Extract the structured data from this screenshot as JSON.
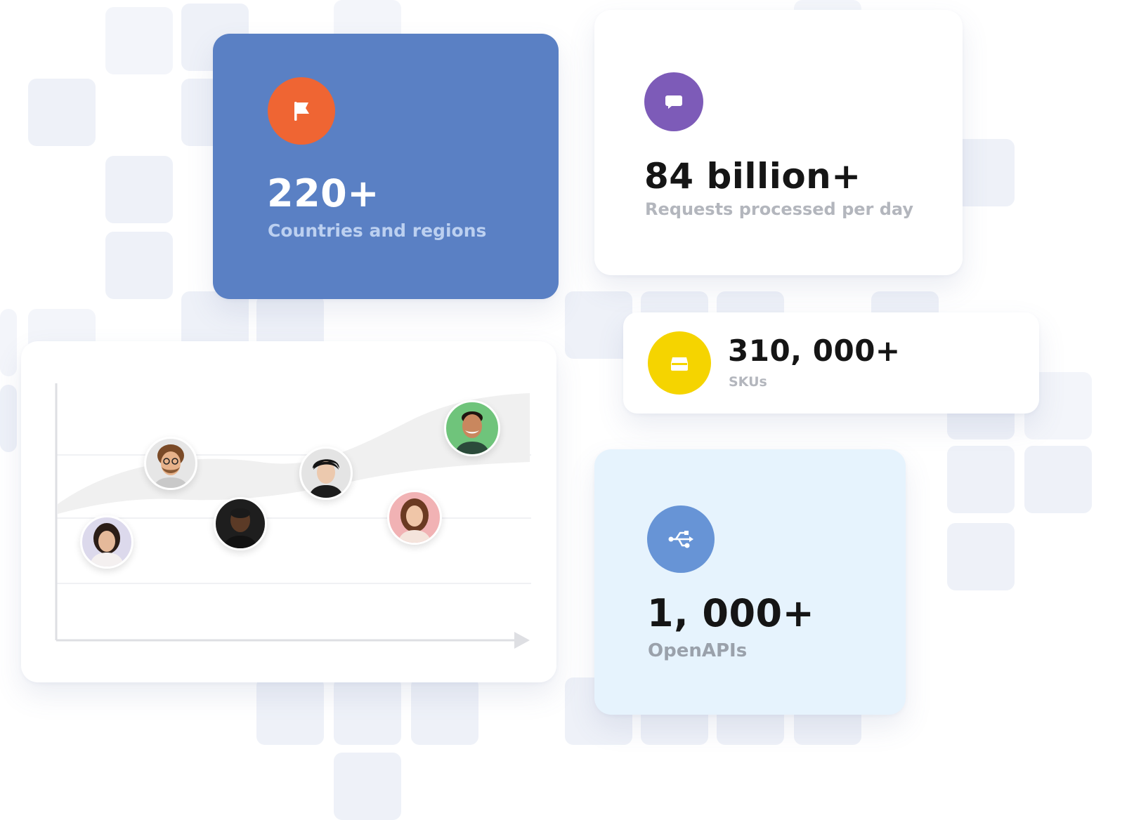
{
  "stats": {
    "countries": {
      "value": "220+",
      "label": "Countries and regions",
      "icon": "flag-icon",
      "color": "#5a80c4",
      "icon_bg": "#ef6533"
    },
    "requests": {
      "value": "84 billion+",
      "label": "Requests processed per day",
      "icon": "chat-bubble-icon",
      "icon_bg": "#7d5bb8"
    },
    "skus": {
      "value": "310, 000+",
      "label": "SKUs",
      "icon": "box-icon",
      "icon_bg": "#f5d400"
    },
    "openapis": {
      "value": "1, 000+",
      "label": "OpenAPIs",
      "icon": "usb-icon",
      "icon_bg": "#6794d6",
      "card_bg": "#e6f3fd"
    }
  },
  "chart_card": {
    "avatars": [
      {
        "name": "avatar-woman-1",
        "bg": "#dcd9ec"
      },
      {
        "name": "avatar-man-glasses",
        "bg": "#e6e6e6"
      },
      {
        "name": "avatar-man-dark",
        "bg": "#1e1e1e"
      },
      {
        "name": "avatar-man-asian",
        "bg": "#e4e4e4"
      },
      {
        "name": "avatar-woman-2",
        "bg": "#f1b2b4"
      },
      {
        "name": "avatar-man-green",
        "bg": "#6fc47b"
      }
    ]
  }
}
